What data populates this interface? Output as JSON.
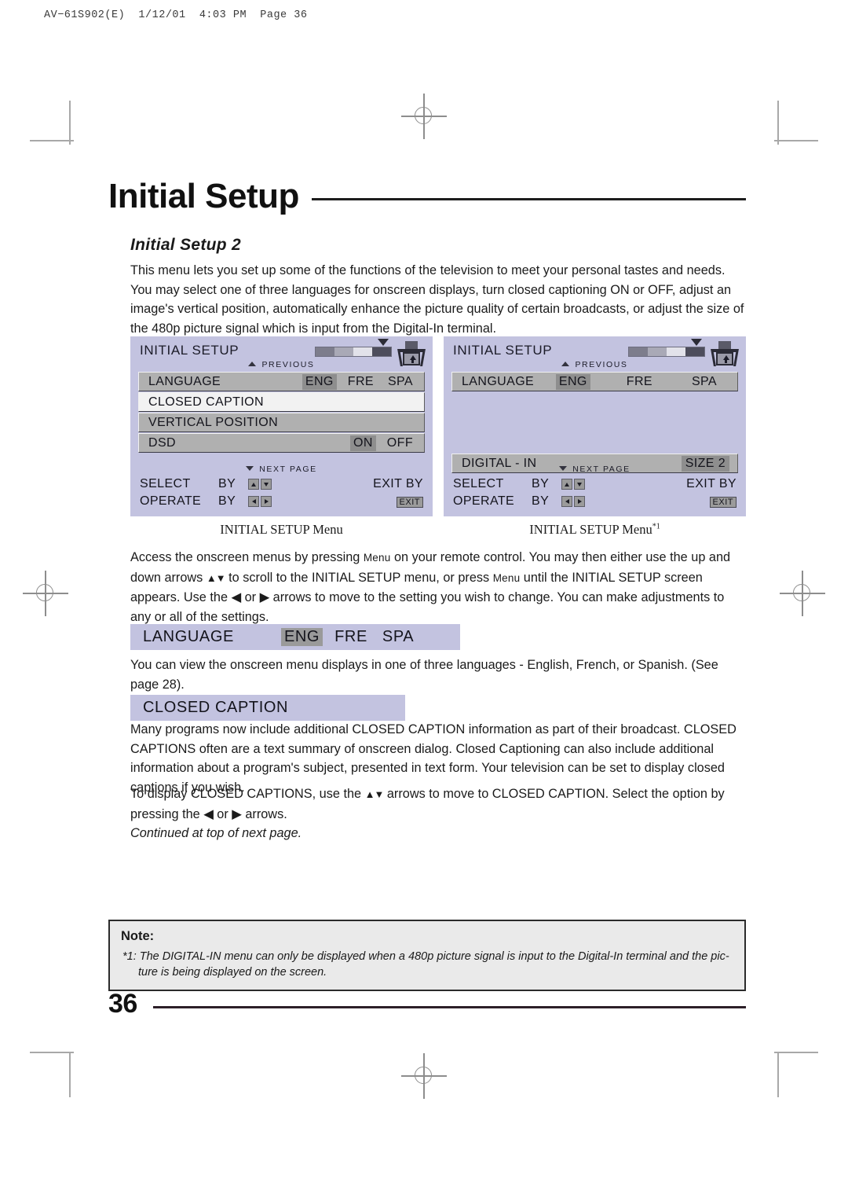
{
  "print_header": "AV−61S902(E)  1/12/01  4:03 PM  Page 36",
  "chapter": {
    "title": "Initial Setup"
  },
  "section": {
    "subhead": "Initial Setup 2",
    "intro": "This menu lets you set up some of the functions of the television to meet your personal tastes and needs. You may select one of three languages for onscreen displays, turn closed captioning ON or OFF, adjust an image's vertical position, automatically enhance the picture quality of certain broadcasts, or adjust the size of the 480p picture signal which is input from the Digital-In terminal."
  },
  "figures": [
    {
      "osd": {
        "title": "INITIAL SETUP",
        "previous_label": "PREVIOUS",
        "next_page_label": "NEXT PAGE",
        "rows": [
          {
            "label": "LANGUAGE",
            "options": [
              "ENG",
              "FRE",
              "SPA"
            ],
            "active": "ENG",
            "selected": false,
            "spacing": "tight"
          },
          {
            "label": "CLOSED CAPTION",
            "options": [],
            "active": "",
            "selected": true,
            "spacing": "tight"
          },
          {
            "label": "VERTICAL POSITION",
            "options": [],
            "active": "",
            "selected": false,
            "spacing": "tight"
          },
          {
            "label": "DSD",
            "options": [
              "ON",
              "OFF"
            ],
            "active": "ON",
            "selected": false,
            "spacing": "tight"
          }
        ],
        "footer": {
          "select_label": "SELECT",
          "operate_label": "OPERATE",
          "by_label": "BY",
          "exit_label": "EXIT BY",
          "exit_chip": "EXIT"
        }
      },
      "caption": "INITIAL SETUP Menu",
      "caption_note": ""
    },
    {
      "osd": {
        "title": "INITIAL SETUP",
        "previous_label": "PREVIOUS",
        "next_page_label": "NEXT PAGE",
        "rows": [
          {
            "label": "LANGUAGE",
            "options": [
              "ENG",
              "FRE",
              "SPA"
            ],
            "active": "ENG",
            "selected": false,
            "spacing": "wide"
          },
          {
            "label": "DIGITAL - IN",
            "options": [
              "SIZE 2"
            ],
            "active": "SIZE 2",
            "selected": false,
            "spacing": "value"
          }
        ],
        "footer": {
          "select_label": "SELECT",
          "operate_label": "OPERATE",
          "by_label": "BY",
          "exit_label": "EXIT BY",
          "exit_chip": "EXIT"
        }
      },
      "caption": "INITIAL SETUP Menu",
      "caption_note": "*1"
    }
  ],
  "paragraphs": {
    "access_1": "Access the onscreen menus by pressing ",
    "access_menu_1": "Menu",
    "access_2": " on your remote control. You may then either use the up and down arrows ",
    "access_arrows_ud": "▲▼",
    "access_3": " to scroll to the INITIAL SETUP menu, or press ",
    "access_menu_2": "Menu",
    "access_4": " until the INITIAL SETUP screen appears. Use the ",
    "access_arrow_l": "◀",
    "access_5": " or ",
    "access_arrow_r": "▶",
    "access_6": " arrows to move to the setting you wish to change. You can make adjustments to any or all of the settings.",
    "language_body": "You can view the onscreen menu displays in one of three languages - English, French, or Spanish. (See page 28).",
    "cc_body_1": "Many programs now include additional CLOSED CAPTION information as part of their broadcast. CLOSED CAPTIONS often are a text summary of onscreen dialog. Closed Captioning can also include additional information about a program's subject, presented in text form. Your television can be set to display closed captions if you wish.",
    "cc_body_2a": "To display CLOSED CAPTIONS, use the ",
    "cc_body_2_arrows": "▲▼",
    "cc_body_2b": " arrows to move to CLOSED CAPTION. Select the option by pressing the ",
    "cc_body_2_left": "◀",
    "cc_body_2c": " or ",
    "cc_body_2_right": "▶",
    "cc_body_2d": " arrows.",
    "continued": "Continued at top of next page."
  },
  "banners": {
    "language": {
      "label": "LANGUAGE",
      "options": [
        "ENG",
        "FRE",
        "SPA"
      ],
      "active": "ENG"
    },
    "closed_caption": {
      "label": "CLOSED CAPTION"
    }
  },
  "note": {
    "title": "Note:",
    "line_1": "*1: The DIGITAL-IN menu can only be displayed when a 480p picture signal is input to the Digital-In terminal and the pic-",
    "line_2": "ture is being displayed on the screen."
  },
  "footer": {
    "page_number": "36"
  },
  "colors": {
    "osd_background": "#c3c3e0",
    "osd_row": "#b0b0b0",
    "osd_row_selected": "#f2f2f2",
    "osd_highlight": "#8e8e8e",
    "note_background": "#eaeaea",
    "rule": "#1d1d1d"
  }
}
